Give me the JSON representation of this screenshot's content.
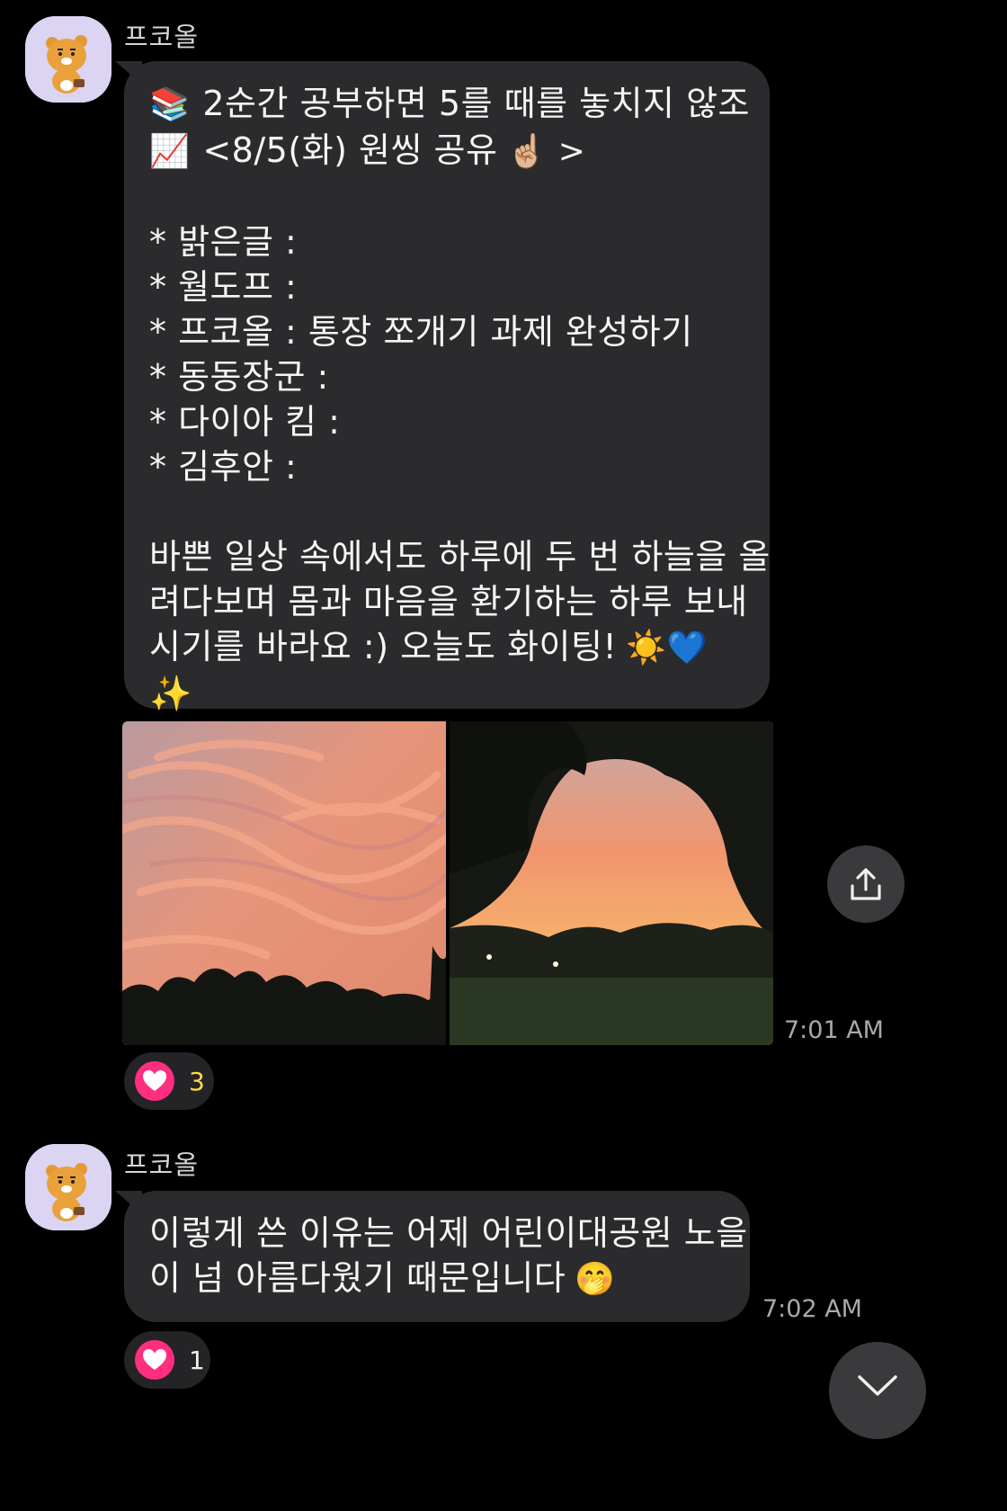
{
  "message1": {
    "sender": "프코올",
    "lines": [
      {
        "icon": "📚",
        "text": "2순간 공부하면 5를 때를 놓치지 않조"
      },
      {
        "icon": "📈",
        "text": "<8/5(화) 원씽 공유",
        "suffix": "☝🏼 >"
      },
      {
        "text": ""
      },
      {
        "text": "* 밝은글 :"
      },
      {
        "text": "* 월도프 :"
      },
      {
        "text": "* 프코올 : 통장 쪼개기 과제 완성하기"
      },
      {
        "text": "* 동동장군 :"
      },
      {
        "text": "* 다이아 킴 :"
      },
      {
        "text": "* 김후안 :"
      },
      {
        "text": ""
      },
      {
        "text": "바쁜 일상 속에서도 하루에 두 번 하늘을 올"
      },
      {
        "text": "려다보며 몸과 마음을 환기하는 하루 보내"
      },
      {
        "text": "시기를 바라요 :) 오늘도 화이팅!",
        "suffix": "☀️💙"
      },
      {
        "text": "✨"
      }
    ],
    "photos": [
      "sunset-clouds-photo",
      "sunset-park-photo"
    ],
    "time": "7:01 AM",
    "reaction": {
      "icon": "heart-icon",
      "count": "3"
    }
  },
  "message2": {
    "sender": "프코올",
    "lines": [
      {
        "text": "이렇게 쓴 이유는 어제 어린이대공원 노을"
      },
      {
        "text": "이 넘 아름다웠기 때문입니다",
        "suffix": "🤭"
      }
    ],
    "time": "7:02 AM",
    "reaction": {
      "icon": "heart-icon",
      "count": "1"
    }
  },
  "controls": {
    "share_icon": "share-upload-icon",
    "scroll_icon": "chevron-down-icon"
  },
  "colors": {
    "background": "#000000",
    "bubble": "#2b2b2d",
    "heart": "#ff2e7e",
    "reaction_count_yellow": "#ffd84a"
  }
}
